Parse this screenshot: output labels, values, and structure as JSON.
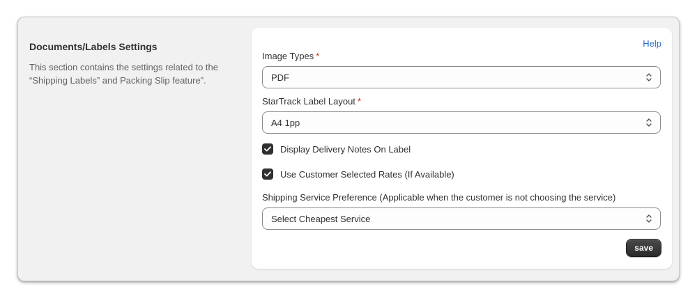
{
  "section": {
    "title": "Documents/Labels Settings",
    "description": "This section contains the settings related to the “Shipping Labels” and Packing Slip feature”."
  },
  "help_label": "Help",
  "image_types": {
    "label": "Image Types",
    "required_mark": "*",
    "value": "PDF"
  },
  "label_layout": {
    "label": "StarTrack Label Layout",
    "required_mark": "*",
    "value": "A4 1pp"
  },
  "checkboxes": [
    {
      "label": "Display Delivery Notes On Label",
      "checked": true
    },
    {
      "label": "Use Customer Selected Rates (If Available)",
      "checked": true
    }
  ],
  "shipping_pref": {
    "label": "Shipping Service Preference (Applicable when the customer is not choosing the service)",
    "value": "Select Cheapest Service"
  },
  "save_label": "save",
  "colors": {
    "help_link": "#2c6ecb",
    "required": "#c5280c",
    "checkbox_fill": "#303030"
  },
  "icons": {
    "select": "select-chevrons-icon",
    "checkbox": "checkmark-icon"
  }
}
